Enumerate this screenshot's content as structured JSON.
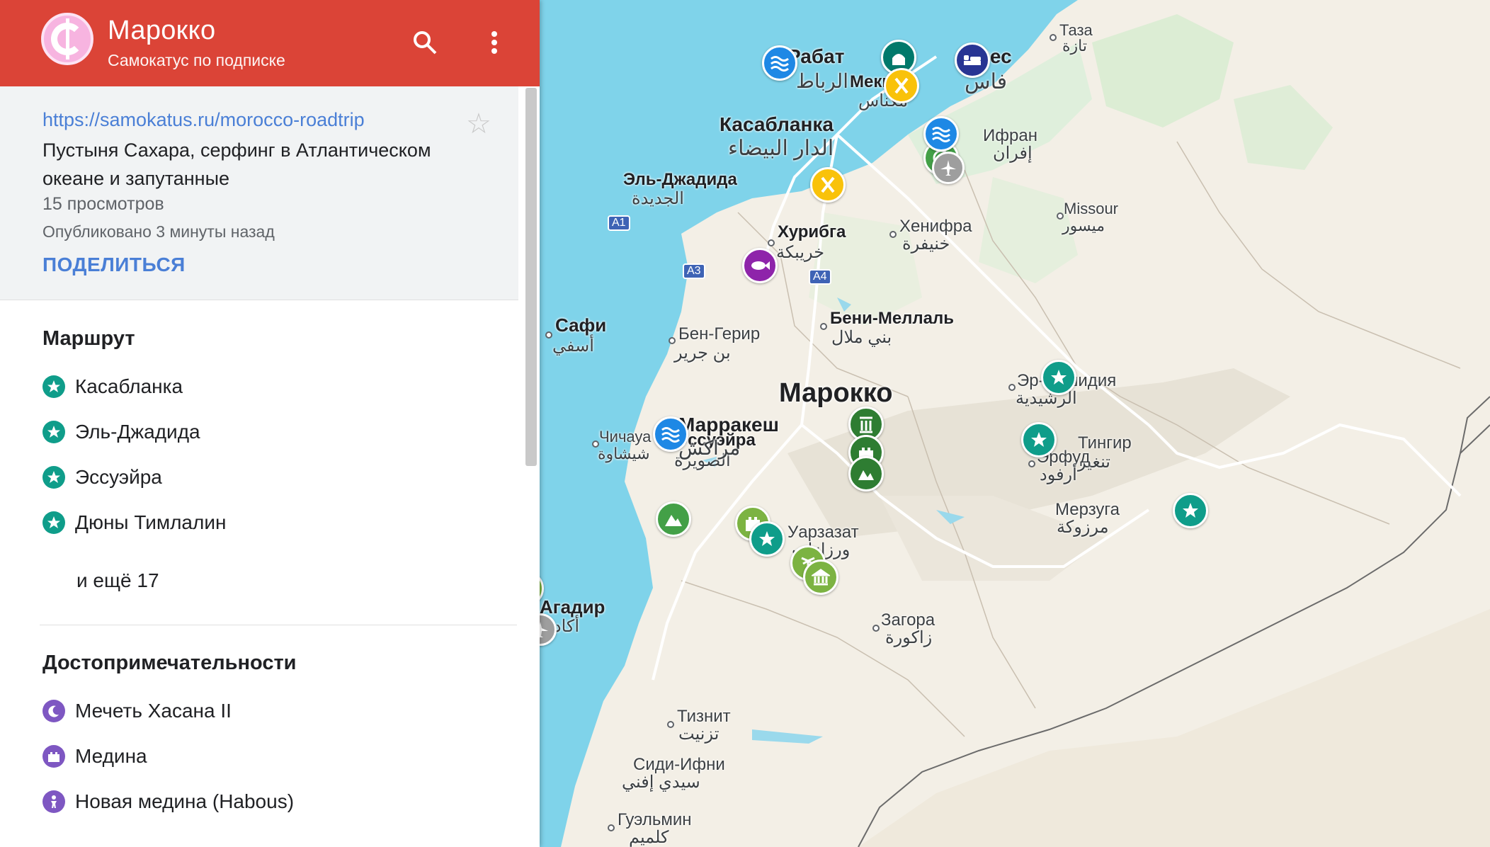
{
  "header": {
    "title": "Марокко",
    "subtitle": "Самокатус по подписке"
  },
  "info": {
    "url": "https://samokatus.ru/morocco-roadtrip",
    "description": "Пустыня Сахара, серфинг в Атлантическом океане и запутанные",
    "views": "15 просмотров",
    "published": "Опубликовано 3 минуты назад",
    "share_label": "ПОДЕЛИТЬСЯ"
  },
  "route": {
    "title": "Маршрут",
    "items": [
      {
        "label": "Касабланка",
        "icon": "star-icon"
      },
      {
        "label": "Эль-Джадида",
        "icon": "star-icon"
      },
      {
        "label": "Эссуэйра",
        "icon": "star-icon"
      },
      {
        "label": "Дюны Тимлалин",
        "icon": "star-icon"
      }
    ],
    "more": "и ещё 17"
  },
  "sights": {
    "title": "Достопримечательности",
    "items": [
      {
        "label": "Мечеть Хасана II",
        "icon": "crescent-icon"
      },
      {
        "label": "Медина",
        "icon": "castle-icon"
      },
      {
        "label": "Новая медина (Habous)",
        "icon": "person-icon"
      }
    ]
  },
  "colors": {
    "header": "#db4437",
    "accent_link": "#4a7fd6",
    "route_icon": "#0f9d8a",
    "sight_icon": "#7e57c2",
    "water": "#7fd3ea",
    "land": "#f4f1ea"
  },
  "map": {
    "country": "Марокко",
    "places": [
      {
        "ru": "Рабат",
        "ar": "الرباط"
      },
      {
        "ru": "Мекнес",
        "ar": "مكناس"
      },
      {
        "ru": "Фес",
        "ar": "فاس"
      },
      {
        "ru": "Таза",
        "ar": "تازة"
      },
      {
        "ru": "Касабланка",
        "ar": "الدار البيضاء"
      },
      {
        "ru": "Ифран",
        "ar": "إفران"
      },
      {
        "ru": "Эль-Джадида",
        "ar": "الجديدة"
      },
      {
        "ru": "Missour",
        "ar": "ميسور"
      },
      {
        "ru": "Хурибга",
        "ar": "خريبكة"
      },
      {
        "ru": "Хенифра",
        "ar": "خنيفرة"
      },
      {
        "ru": "Сафи",
        "ar": "أسفي"
      },
      {
        "ru": "Бен-Герир",
        "ar": "بن جرير"
      },
      {
        "ru": "Бени-Меллаль",
        "ar": "بني ملال"
      },
      {
        "ru": "Эр-Рашидия",
        "ar": "الرشيدية"
      },
      {
        "ru": "Эссуэйра",
        "ar": "الصويرة"
      },
      {
        "ru": "Чичауа",
        "ar": "شيشاوة"
      },
      {
        "ru": "Марракеш",
        "ar": "مراكش"
      },
      {
        "ru": "Тингир",
        "ar": "تنغير"
      },
      {
        "ru": "Эрфуд",
        "ar": "أرفود"
      },
      {
        "ru": "Мерзуга",
        "ar": "مرزوكة"
      },
      {
        "ru": "Уарзазат",
        "ar": "ورزازات"
      },
      {
        "ru": "Агадир",
        "ar": "أكادير"
      },
      {
        "ru": "Загора",
        "ar": "زاكورة"
      },
      {
        "ru": "Тизнит",
        "ar": "تزنيت"
      },
      {
        "ru": "Сиди-Ифни",
        "ar": "سيدي إفني"
      },
      {
        "ru": "Гуэльмин",
        "ar": "كلميم"
      }
    ],
    "roads": [
      "A1",
      "A3",
      "A4"
    ]
  }
}
